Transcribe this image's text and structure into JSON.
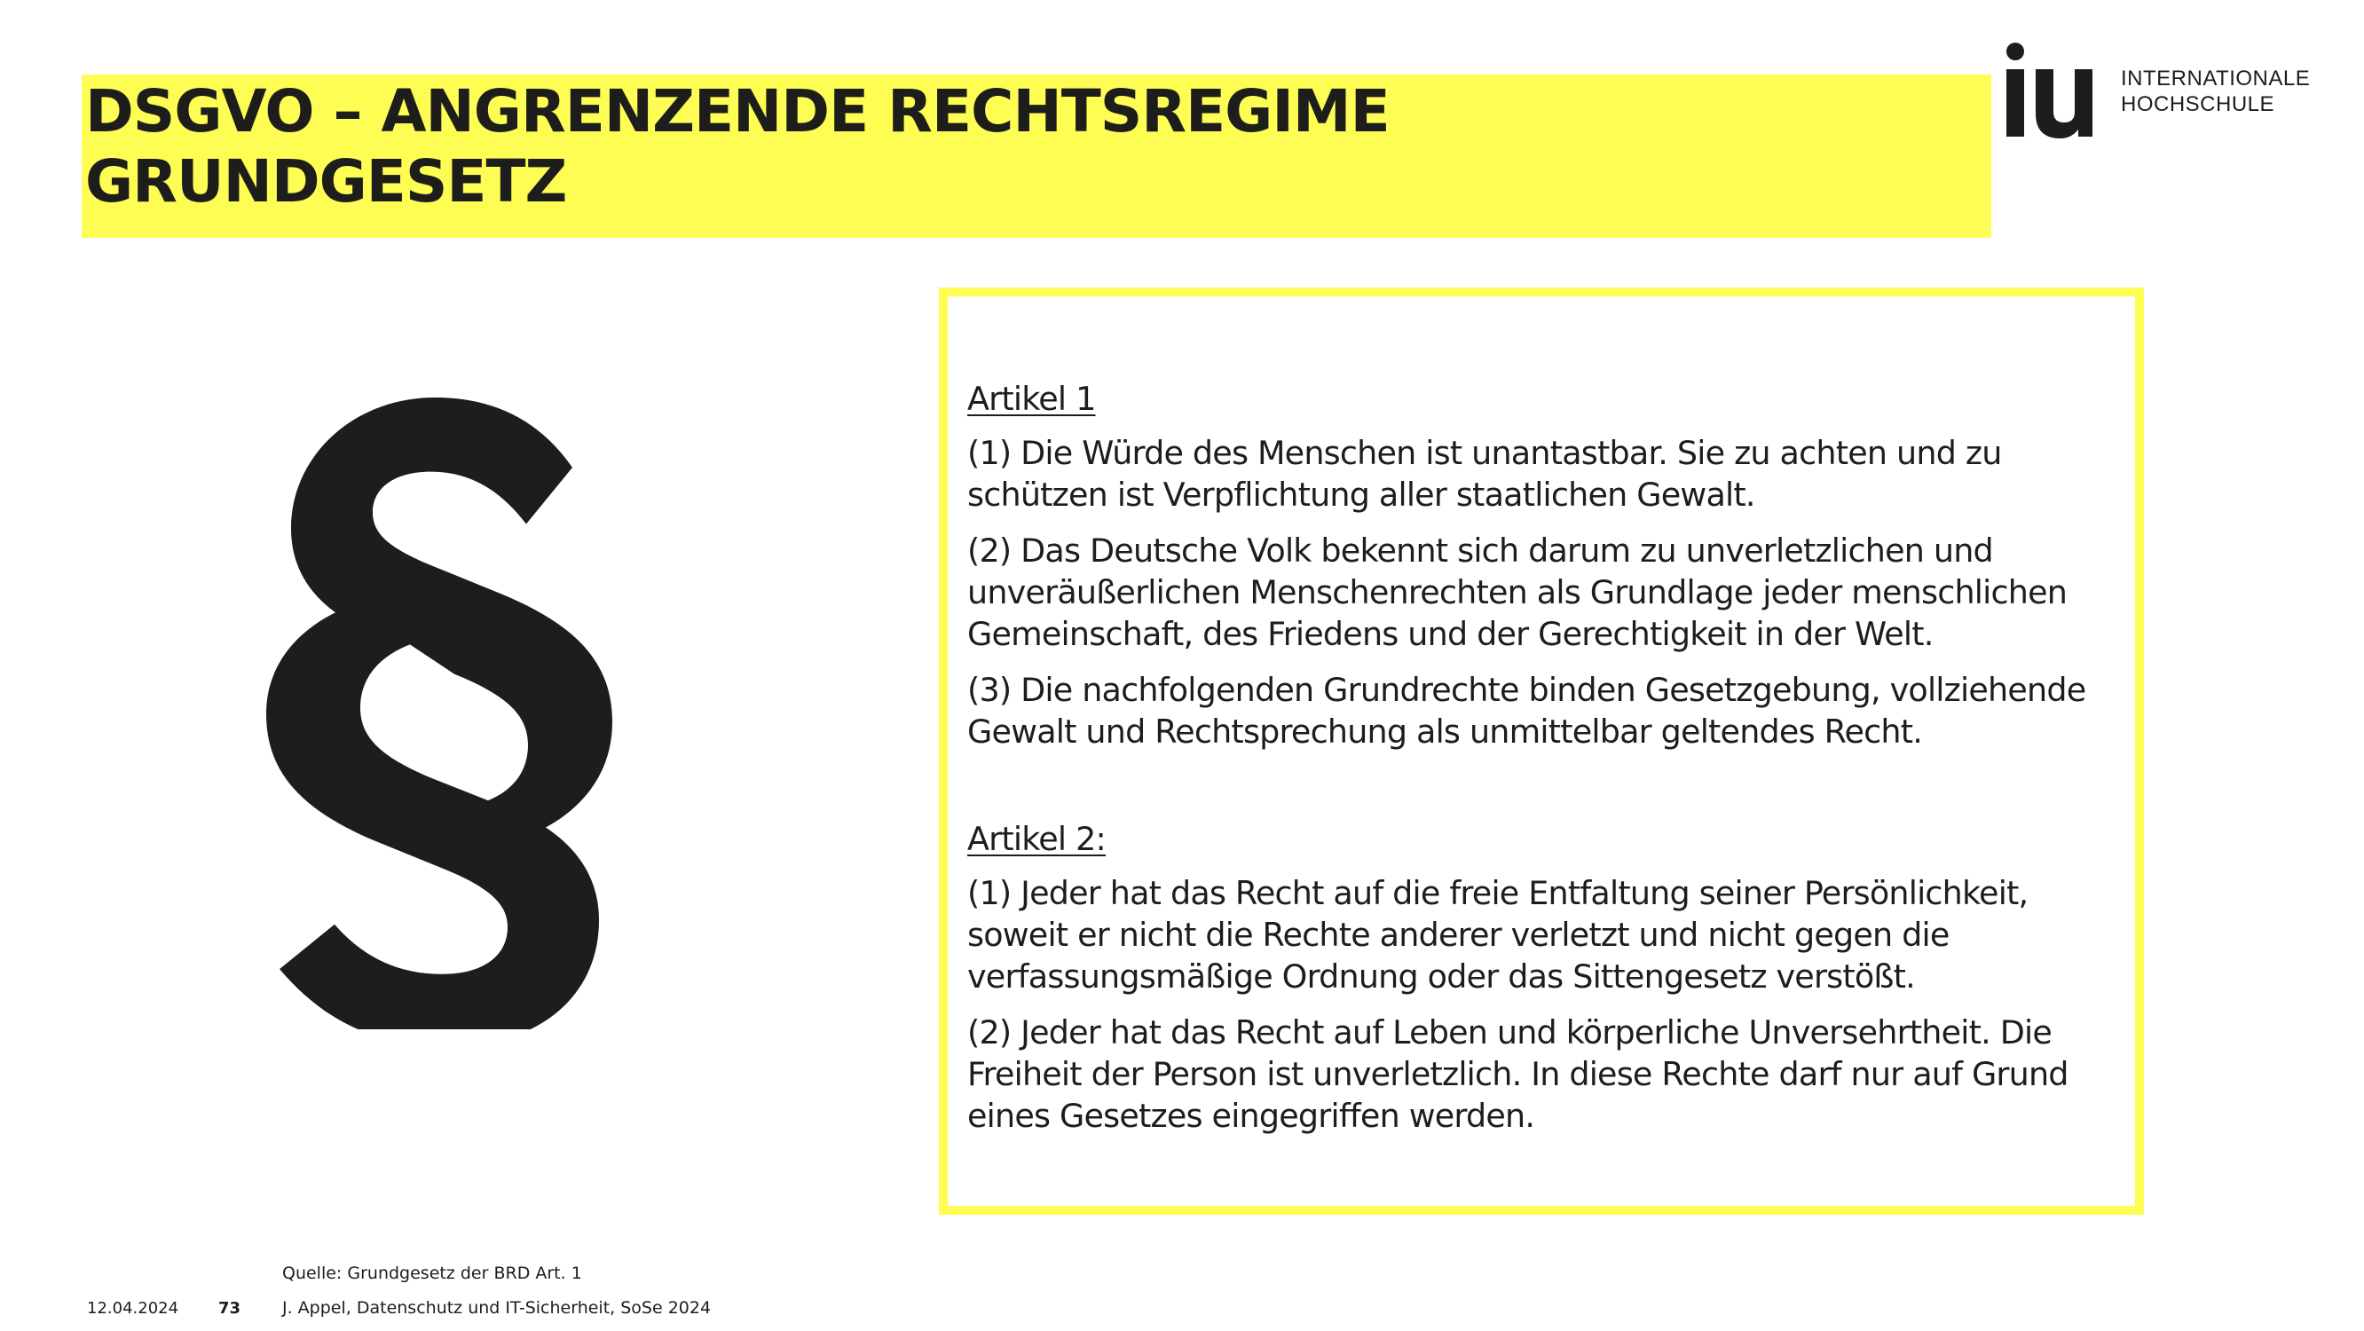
{
  "header": {
    "title_line1": "DSGVO – ANGRENZENDE RECHTSREGIME",
    "title_line2": "GRUNDGESETZ",
    "highlight_color": "#fefd53"
  },
  "logo": {
    "mark": "iu",
    "text_line1": "INTERNATIONALE",
    "text_line2": "HOCHSCHULE"
  },
  "symbol": {
    "glyph": "§",
    "icon": "paragraph-symbol-icon"
  },
  "content": {
    "article1": {
      "heading": "Artikel 1",
      "paragraphs": [
        "(1) Die Würde des Menschen ist unantastbar. Sie zu achten und zu schützen ist Verpflichtung aller staatlichen Gewalt.",
        "(2) Das Deutsche Volk bekennt sich darum zu unverletzlichen und unveräußerlichen Menschenrechten als Grundlage jeder menschlichen Gemeinschaft, des Friedens und der Gerechtigkeit in der Welt.",
        "(3) Die nachfolgenden Grundrechte binden Gesetzgebung, vollziehende Gewalt und Rechtsprechung als unmittelbar geltendes Recht."
      ]
    },
    "article2": {
      "heading": "Artikel 2:",
      "paragraphs": [
        "(1) Jeder hat das Recht auf die freie Entfaltung seiner Persönlichkeit, soweit er nicht die Rechte anderer verletzt und nicht gegen die verfassungsmäßige Ordnung oder das Sittengesetz verstößt.",
        "(2) Jeder hat das Recht auf Leben und körperliche Unversehrtheit. Die Freiheit der Person ist unverletzlich. In diese Rechte darf nur auf Grund eines Gesetzes eingegriffen werden."
      ]
    }
  },
  "footer": {
    "source": "Quelle: Grundgesetz der BRD Art. 1",
    "date": "12.04.2024",
    "page": "73",
    "author": "J. Appel, Datenschutz und IT-Sicherheit, SoSe 2024"
  }
}
